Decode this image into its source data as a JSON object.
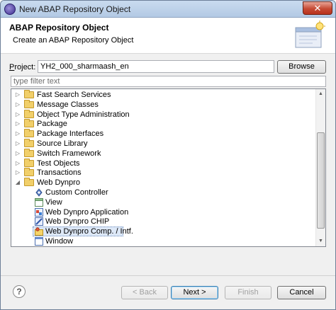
{
  "window": {
    "title": "New ABAP Repository Object",
    "close_glyph": "✕"
  },
  "header": {
    "title": "ABAP Repository Object",
    "subtitle": "Create an ABAP Repository Object"
  },
  "project": {
    "label_prefix": "P",
    "label_rest": "roject:",
    "value": "YH2_000_sharmaash_en",
    "browse_label": "Browse"
  },
  "filter": {
    "placeholder": "type filter text"
  },
  "tree": {
    "items": [
      {
        "label": "Fast Search Services",
        "expanded": false,
        "kind": "folder"
      },
      {
        "label": "Message Classes",
        "expanded": false,
        "kind": "folder"
      },
      {
        "label": "Object Type Administration",
        "expanded": false,
        "kind": "folder"
      },
      {
        "label": "Package",
        "expanded": false,
        "kind": "folder"
      },
      {
        "label": "Package Interfaces",
        "expanded": false,
        "kind": "folder"
      },
      {
        "label": "Source Library",
        "expanded": false,
        "kind": "folder"
      },
      {
        "label": "Switch Framework",
        "expanded": false,
        "kind": "folder"
      },
      {
        "label": "Test Objects",
        "expanded": false,
        "kind": "folder"
      },
      {
        "label": "Transactions",
        "expanded": false,
        "kind": "folder"
      },
      {
        "label": "Web Dynpro",
        "expanded": true,
        "kind": "folder"
      }
    ],
    "children": [
      {
        "label": "Custom Controller",
        "icon": "custom-controller-icon"
      },
      {
        "label": "View",
        "icon": "view-icon"
      },
      {
        "label": "Web Dynpro Application",
        "icon": "wd-application-icon"
      },
      {
        "label": "Web Dynpro CHIP",
        "icon": "wd-chip-icon"
      },
      {
        "label": "Web Dynpro Comp. / Intf.",
        "icon": "wd-component-icon",
        "selected": true
      },
      {
        "label": "Window",
        "icon": "window-icon"
      }
    ]
  },
  "footer": {
    "help_glyph": "?",
    "back_label": "< Back",
    "next_label": "Next >",
    "finish_label": "Finish",
    "cancel_label": "Cancel"
  },
  "colors": {
    "accent": "#3c7fb1",
    "selection": "#dde8f7",
    "folder": "#f1cf6a"
  }
}
